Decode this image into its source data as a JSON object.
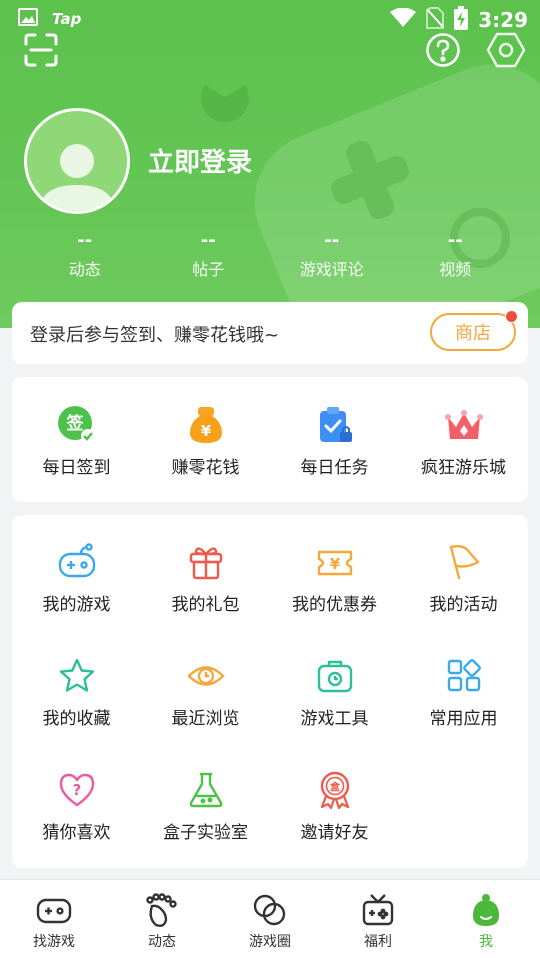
{
  "status_bar": {
    "app_label": "Tap",
    "time": "3:29",
    "icons": [
      "image-icon",
      "wifi-icon",
      "no-sim-icon",
      "battery-charging-icon"
    ]
  },
  "header": {
    "scan_icon": "scan-icon",
    "help_icon": "help-icon",
    "settings_icon": "settings-icon",
    "login_text": "立即登录",
    "stats": [
      {
        "value": "--",
        "label": "动态"
      },
      {
        "value": "--",
        "label": "帖子"
      },
      {
        "value": "--",
        "label": "游戏评论"
      },
      {
        "value": "--",
        "label": "视频"
      }
    ]
  },
  "signin_banner": {
    "text": "登录后参与签到、赚零花钱哦~",
    "shop_label": "商店"
  },
  "quick_actions": [
    {
      "label": "每日签到",
      "icon": "checkin-icon",
      "icon_text": "签"
    },
    {
      "label": "赚零花钱",
      "icon": "money-bag-icon",
      "icon_text": "¥"
    },
    {
      "label": "每日任务",
      "icon": "task-clipboard-icon"
    },
    {
      "label": "疯狂游乐城",
      "icon": "crown-icon"
    }
  ],
  "menu_items": [
    {
      "label": "我的游戏",
      "icon": "gamepad-icon"
    },
    {
      "label": "我的礼包",
      "icon": "gift-icon"
    },
    {
      "label": "我的优惠券",
      "icon": "coupon-icon",
      "icon_text": "¥"
    },
    {
      "label": "我的活动",
      "icon": "flag-icon"
    },
    {
      "label": "我的收藏",
      "icon": "star-icon"
    },
    {
      "label": "最近浏览",
      "icon": "eye-icon"
    },
    {
      "label": "游戏工具",
      "icon": "toolbox-icon"
    },
    {
      "label": "常用应用",
      "icon": "apps-icon"
    },
    {
      "label": "猜你喜欢",
      "icon": "heart-question-icon",
      "icon_text": "?"
    },
    {
      "label": "盒子实验室",
      "icon": "flask-icon"
    },
    {
      "label": "邀请好友",
      "icon": "invite-badge-icon",
      "icon_text": "盒"
    }
  ],
  "bottom_nav": [
    {
      "label": "找游戏",
      "icon": "gamepad-outline-icon",
      "active": false
    },
    {
      "label": "动态",
      "icon": "footprint-icon",
      "active": false
    },
    {
      "label": "游戏圈",
      "icon": "circles-icon",
      "active": false
    },
    {
      "label": "福利",
      "icon": "gift-tv-icon",
      "active": false
    },
    {
      "label": "我",
      "icon": "mascot-icon",
      "active": true
    }
  ],
  "colors": {
    "brand_green": "#5cc24c",
    "shop_orange": "#f4a73a",
    "active_tab": "#4cb83b",
    "notification_dot": "#f04b3e"
  }
}
